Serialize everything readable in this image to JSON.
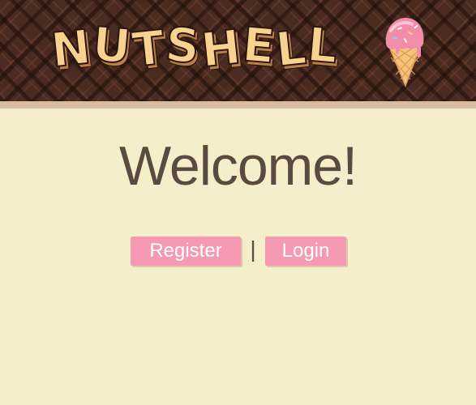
{
  "header": {
    "logo_letters": [
      "N",
      "U",
      "T",
      "S",
      "H",
      "E",
      "L",
      "L"
    ],
    "logo_icon": "ice-cream-cone-icon"
  },
  "main": {
    "welcome": "Welcome!",
    "register_label": "Register",
    "separator": "|",
    "login_label": "Login"
  },
  "colors": {
    "background": "#f4eecb",
    "header": "#4a2b21",
    "button": "#f69ab3",
    "text": "#5a4a40",
    "logo": "#f8d28f"
  }
}
